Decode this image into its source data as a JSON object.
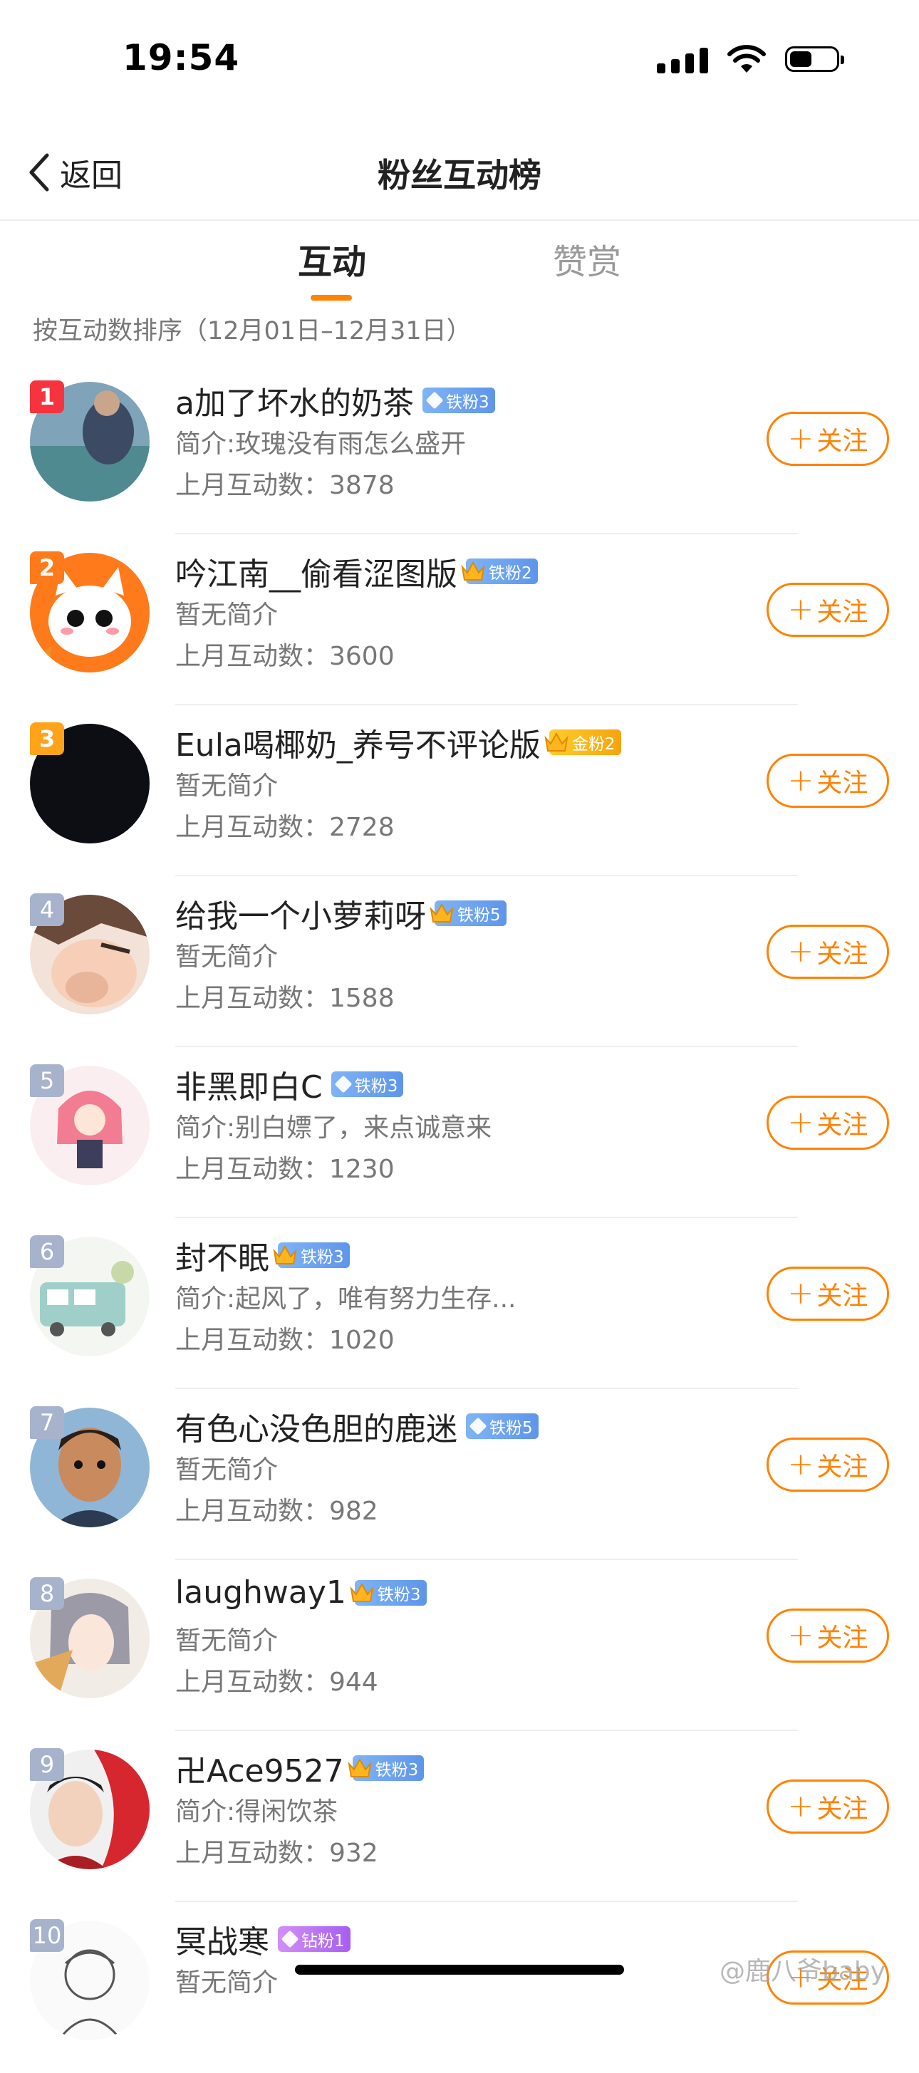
{
  "status_bar": {
    "time": "19:54"
  },
  "nav": {
    "back_label": "返回",
    "title": "粉丝互动榜"
  },
  "tabs": [
    {
      "label": "互动",
      "active": true
    },
    {
      "label": "赞赏",
      "active": false
    }
  ],
  "sort_note": "按互动数排序（12月01日–12月31日）",
  "follow_label": "关注",
  "accent_color": "#ff8200",
  "users": [
    {
      "rank": "1",
      "name": "a加了坏水的奶茶",
      "badge": "铁粉3",
      "badge_type": "iron",
      "badge_icon": "gem-icon",
      "intro": "简介:玫瑰没有雨怎么盛开",
      "count": "上月互动数：3878"
    },
    {
      "rank": "2",
      "name": "吟江南__偷看涩图版",
      "badge": "铁粉2",
      "badge_type": "iron",
      "badge_icon": "crown-icon",
      "intro": "暂无简介",
      "count": "上月互动数：3600"
    },
    {
      "rank": "3",
      "name": "Eula喝椰奶_养号不评论版",
      "badge": "金粉2",
      "badge_type": "gold",
      "badge_icon": "crown-icon",
      "intro": "暂无简介",
      "count": "上月互动数：2728"
    },
    {
      "rank": "4",
      "name": "给我一个小萝莉呀",
      "badge": "铁粉5",
      "badge_type": "iron",
      "badge_icon": "crown-icon",
      "intro": "暂无简介",
      "count": "上月互动数：1588"
    },
    {
      "rank": "5",
      "name": "非黑即白C",
      "badge": "铁粉3",
      "badge_type": "iron",
      "badge_icon": "gem-icon",
      "intro": "简介:别白嫖了，来点诚意来",
      "count": "上月互动数：1230"
    },
    {
      "rank": "6",
      "name": "封不眠",
      "badge": "铁粉3",
      "badge_type": "iron",
      "badge_icon": "crown-icon",
      "intro": "简介:起风了，唯有努力生存...",
      "count": "上月互动数：1020"
    },
    {
      "rank": "7",
      "name": "有色心没色胆的鹿迷",
      "badge": "铁粉5",
      "badge_type": "iron",
      "badge_icon": "gem-icon",
      "intro": "暂无简介",
      "count": "上月互动数：982"
    },
    {
      "rank": "8",
      "name": "laughway1",
      "badge": "铁粉3",
      "badge_type": "iron",
      "badge_icon": "crown-icon",
      "intro": "暂无简介",
      "count": "上月互动数：944"
    },
    {
      "rank": "9",
      "name": "卍Ace9527",
      "badge": "铁粉3",
      "badge_type": "iron",
      "badge_icon": "crown-icon",
      "intro": "简介:得闲饮茶",
      "count": "上月互动数：932"
    },
    {
      "rank": "10",
      "name": "冥战寒",
      "badge": "钻粉1",
      "badge_type": "diamond",
      "badge_icon": "gem-icon",
      "intro": "暂无简介",
      "count": ""
    }
  ],
  "watermark": "@鹿八爷baby"
}
